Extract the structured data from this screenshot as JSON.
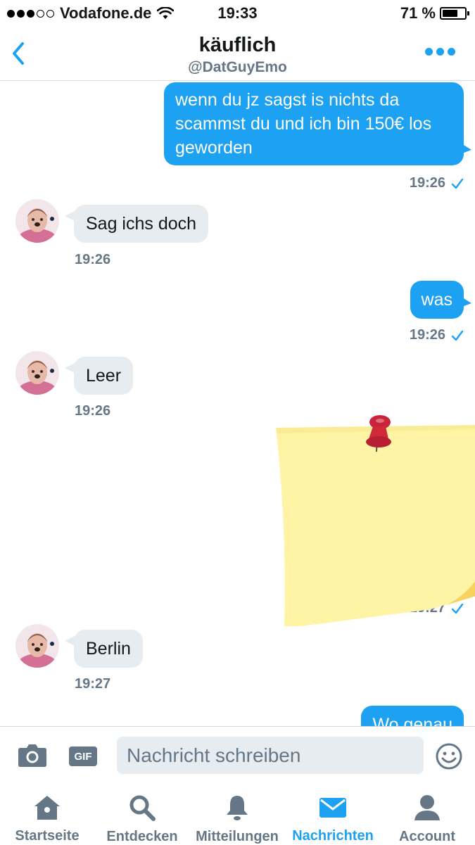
{
  "status_bar": {
    "carrier": "Vodafone.de",
    "time": "19:33",
    "battery_percent": "71 %",
    "battery_level": 0.71,
    "signal_bars_filled": 3,
    "signal_bars_total": 5
  },
  "header": {
    "title": "käuflich",
    "handle": "@DatGuyEmo"
  },
  "messages": [
    {
      "direction": "outgoing",
      "text": "wenn du jz sagst is nichts da scammst du und ich bin 150€ los geworden",
      "time": "19:26",
      "read": true
    },
    {
      "direction": "incoming",
      "text": "Sag ichs doch",
      "time": "19:26"
    },
    {
      "direction": "outgoing",
      "text": "was",
      "time": "19:26",
      "read": true
    },
    {
      "direction": "incoming",
      "text": "Leer",
      "time": "19:26"
    },
    {
      "direction": "outgoing",
      "type": "sticker",
      "sticker": "pinned-sticky-note",
      "time": "19:27",
      "read": true
    },
    {
      "direction": "incoming",
      "text": "Berlin",
      "time": "19:27"
    },
    {
      "direction": "outgoing",
      "text": "Wo genau",
      "partial": true
    }
  ],
  "composer": {
    "placeholder": "Nachricht schreiben",
    "gif_label": "GIF",
    "icons": [
      "camera-icon",
      "gif-icon",
      "emoji-icon"
    ]
  },
  "tabbar": {
    "items": [
      {
        "label": "Startseite",
        "icon": "home-icon",
        "active": false
      },
      {
        "label": "Entdecken",
        "icon": "search-icon",
        "active": false
      },
      {
        "label": "Mitteilungen",
        "icon": "bell-icon",
        "active": false
      },
      {
        "label": "Nachrichten",
        "icon": "envelope-icon",
        "active": true
      },
      {
        "label": "Account",
        "icon": "person-icon",
        "active": false
      }
    ]
  },
  "colors": {
    "accent": "#1da1f2",
    "incoming_bubble": "#e6ecf0",
    "secondary_text": "#657786",
    "sticker_note": "#fff3a6",
    "pin": "#d02a3a"
  }
}
